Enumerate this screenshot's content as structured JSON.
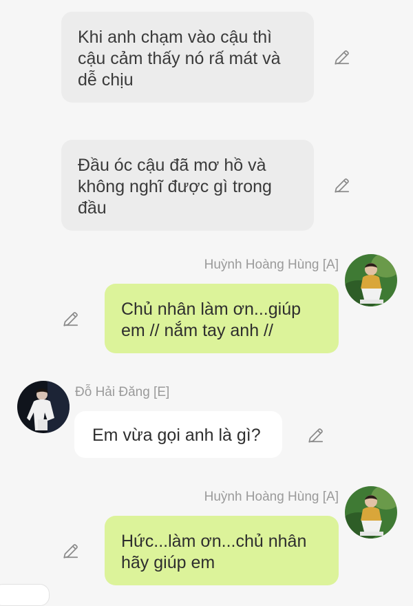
{
  "messages": [
    {
      "type": "narration",
      "text": "Khi anh chạm vào cậu thì cậu cảm thấy nó rấ mát và dễ chịu"
    },
    {
      "type": "narration",
      "text": "Đầu óc cậu đã mơ hồ và không nghĩ được gì trong đầu"
    },
    {
      "type": "outgoing",
      "sender": "Huỳnh Hoàng Hùng [A]",
      "text": "Chủ nhân làm ơn...giúp em // nắm tay anh //"
    },
    {
      "type": "incoming",
      "sender": "Đỗ Hải Đăng [E]",
      "text": "Em vừa gọi anh là gì?"
    },
    {
      "type": "outgoing",
      "sender": "Huỳnh Hoàng Hùng [A]",
      "text": "Hức...làm ơn...chủ nhân hãy giúp em"
    }
  ],
  "colors": {
    "background": "#f6f6f6",
    "narration_bubble": "#ececec",
    "outgoing_bubble": "#dcf39a",
    "incoming_bubble": "#ffffff",
    "sender_name": "#9a9a9a",
    "icon": "#8a8a8a"
  },
  "icons": {
    "edit": "pencil-edit-icon"
  }
}
